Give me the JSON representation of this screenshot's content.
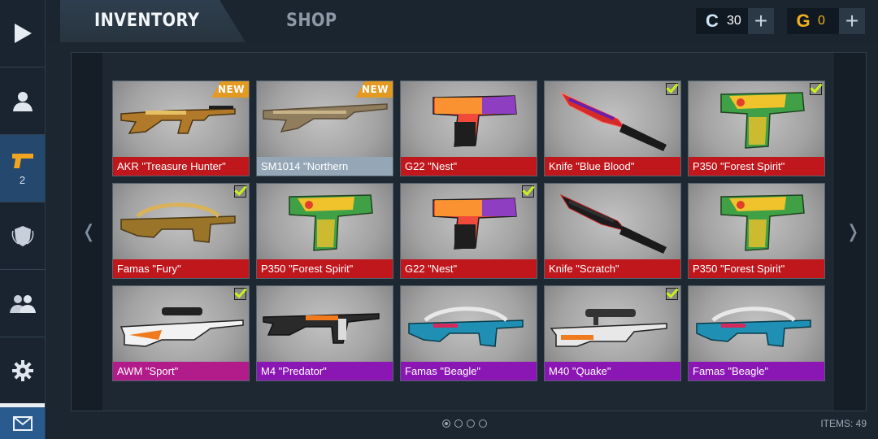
{
  "header": {
    "tabs": [
      {
        "label": "INVENTORY",
        "active": true
      },
      {
        "label": "SHOP",
        "active": false
      }
    ],
    "currencies": [
      {
        "icon": "C",
        "value": "30",
        "color": "#cfe3f5"
      },
      {
        "icon": "G",
        "value": "0",
        "color": "#f2b01e"
      }
    ],
    "add_icon": "+"
  },
  "sidebar": {
    "items": [
      {
        "name": "play",
        "icon": "play-icon"
      },
      {
        "name": "profile",
        "icon": "user-icon"
      },
      {
        "name": "inventory",
        "icon": "pistol-icon",
        "count": "2",
        "active": true
      },
      {
        "name": "clan",
        "icon": "shield-icon"
      },
      {
        "name": "friends",
        "icon": "friends-icon"
      },
      {
        "name": "settings",
        "icon": "gear-icon"
      }
    ],
    "mail_icon": "envelope-icon"
  },
  "nav": {
    "prev": "❬",
    "next": "❭"
  },
  "inventory": {
    "items": [
      {
        "name": "AKR \"Treasure Hunter\"",
        "weapon": "rifle",
        "badge": "NEW",
        "rarity": "red",
        "color": "#c0171d",
        "skin": [
          "#b07a2a",
          "#e7c064",
          "#4a3414"
        ]
      },
      {
        "name": "SM1014 \"Northern",
        "weapon": "shotgun",
        "badge": "NEW",
        "rarity": "grey",
        "color": "#95a7b6",
        "skin": [
          "#8f7d5e",
          "#c9b48a",
          "#5a4a36"
        ]
      },
      {
        "name": "G22 \"Nest\"",
        "weapon": "pistol",
        "badge": "",
        "rarity": "red",
        "color": "#c0171d",
        "skin": [
          "#f04a3a",
          "#ffb02e",
          "#8e3ec0"
        ]
      },
      {
        "name": "Knife \"Blue Blood\"",
        "weapon": "knife",
        "badge": "check",
        "rarity": "red",
        "color": "#c0171d",
        "skin": [
          "#d42a2a",
          "#6c1fa8",
          "#ff7b6e"
        ]
      },
      {
        "name": "P350 \"Forest Spirit\"",
        "weapon": "pistol2",
        "badge": "check",
        "rarity": "red",
        "color": "#c0171d",
        "skin": [
          "#3fa046",
          "#f0c22c",
          "#e0402a"
        ]
      },
      {
        "name": "Famas \"Fury\"",
        "weapon": "famas",
        "badge": "check",
        "rarity": "red",
        "color": "#c0171d",
        "skin": [
          "#9a7428",
          "#d9b259",
          "#4a3818"
        ]
      },
      {
        "name": "P350 \"Forest Spirit\"",
        "weapon": "pistol2",
        "badge": "",
        "rarity": "red",
        "color": "#c0171d",
        "skin": [
          "#3fa046",
          "#f0c22c",
          "#e0402a"
        ]
      },
      {
        "name": "G22 \"Nest\"",
        "weapon": "pistol",
        "badge": "check",
        "rarity": "red",
        "color": "#c0171d",
        "skin": [
          "#f04a3a",
          "#ffb02e",
          "#8e3ec0"
        ]
      },
      {
        "name": "Knife \"Scratch\"",
        "weapon": "knife",
        "badge": "",
        "rarity": "red",
        "color": "#c0171d",
        "skin": [
          "#1c1c1c",
          "#303030",
          "#c42020"
        ]
      },
      {
        "name": "P350 \"Forest Spirit\"",
        "weapon": "pistol2",
        "badge": "",
        "rarity": "red",
        "color": "#c0171d",
        "skin": [
          "#3fa046",
          "#f0c22c",
          "#e0402a"
        ]
      },
      {
        "name": "AWM \"Sport\"",
        "weapon": "sniper",
        "badge": "check",
        "rarity": "pink",
        "color": "#b21b8a",
        "skin": [
          "#f2f2f2",
          "#f07a1c",
          "#222222"
        ]
      },
      {
        "name": "M4 \"Predator\"",
        "weapon": "m4",
        "badge": "",
        "rarity": "purple",
        "color": "#8a17b4",
        "skin": [
          "#2a2a2a",
          "#f07a1c",
          "#dcdcdc"
        ]
      },
      {
        "name": "Famas \"Beagle\"",
        "weapon": "famas2",
        "badge": "",
        "rarity": "purple",
        "color": "#8a17b4",
        "skin": [
          "#1f8fb4",
          "#e8e8e8",
          "#d6285a"
        ]
      },
      {
        "name": "M40 \"Quake\"",
        "weapon": "sniper2",
        "badge": "check",
        "rarity": "purple",
        "color": "#8a17b4",
        "skin": [
          "#e8e8e8",
          "#333333",
          "#f07a1c"
        ]
      },
      {
        "name": "Famas \"Beagle\"",
        "weapon": "famas2",
        "badge": "",
        "rarity": "purple",
        "color": "#8a17b4",
        "skin": [
          "#1f8fb4",
          "#e8e8e8",
          "#d6285a"
        ]
      }
    ]
  },
  "pagination": {
    "pages": 4,
    "current": 1
  },
  "footer": {
    "items_count": "ITEMS: 49"
  }
}
